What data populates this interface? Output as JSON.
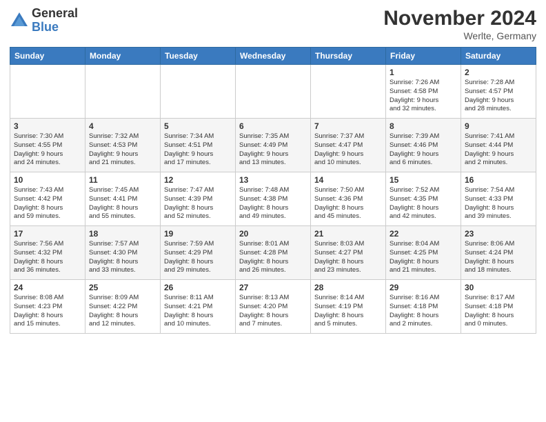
{
  "logo": {
    "general": "General",
    "blue": "Blue"
  },
  "header": {
    "title": "November 2024",
    "location": "Werlte, Germany"
  },
  "weekdays": [
    "Sunday",
    "Monday",
    "Tuesday",
    "Wednesday",
    "Thursday",
    "Friday",
    "Saturday"
  ],
  "weeks": [
    [
      {
        "day": "",
        "info": ""
      },
      {
        "day": "",
        "info": ""
      },
      {
        "day": "",
        "info": ""
      },
      {
        "day": "",
        "info": ""
      },
      {
        "day": "",
        "info": ""
      },
      {
        "day": "1",
        "info": "Sunrise: 7:26 AM\nSunset: 4:58 PM\nDaylight: 9 hours\nand 32 minutes."
      },
      {
        "day": "2",
        "info": "Sunrise: 7:28 AM\nSunset: 4:57 PM\nDaylight: 9 hours\nand 28 minutes."
      }
    ],
    [
      {
        "day": "3",
        "info": "Sunrise: 7:30 AM\nSunset: 4:55 PM\nDaylight: 9 hours\nand 24 minutes."
      },
      {
        "day": "4",
        "info": "Sunrise: 7:32 AM\nSunset: 4:53 PM\nDaylight: 9 hours\nand 21 minutes."
      },
      {
        "day": "5",
        "info": "Sunrise: 7:34 AM\nSunset: 4:51 PM\nDaylight: 9 hours\nand 17 minutes."
      },
      {
        "day": "6",
        "info": "Sunrise: 7:35 AM\nSunset: 4:49 PM\nDaylight: 9 hours\nand 13 minutes."
      },
      {
        "day": "7",
        "info": "Sunrise: 7:37 AM\nSunset: 4:47 PM\nDaylight: 9 hours\nand 10 minutes."
      },
      {
        "day": "8",
        "info": "Sunrise: 7:39 AM\nSunset: 4:46 PM\nDaylight: 9 hours\nand 6 minutes."
      },
      {
        "day": "9",
        "info": "Sunrise: 7:41 AM\nSunset: 4:44 PM\nDaylight: 9 hours\nand 2 minutes."
      }
    ],
    [
      {
        "day": "10",
        "info": "Sunrise: 7:43 AM\nSunset: 4:42 PM\nDaylight: 8 hours\nand 59 minutes."
      },
      {
        "day": "11",
        "info": "Sunrise: 7:45 AM\nSunset: 4:41 PM\nDaylight: 8 hours\nand 55 minutes."
      },
      {
        "day": "12",
        "info": "Sunrise: 7:47 AM\nSunset: 4:39 PM\nDaylight: 8 hours\nand 52 minutes."
      },
      {
        "day": "13",
        "info": "Sunrise: 7:48 AM\nSunset: 4:38 PM\nDaylight: 8 hours\nand 49 minutes."
      },
      {
        "day": "14",
        "info": "Sunrise: 7:50 AM\nSunset: 4:36 PM\nDaylight: 8 hours\nand 45 minutes."
      },
      {
        "day": "15",
        "info": "Sunrise: 7:52 AM\nSunset: 4:35 PM\nDaylight: 8 hours\nand 42 minutes."
      },
      {
        "day": "16",
        "info": "Sunrise: 7:54 AM\nSunset: 4:33 PM\nDaylight: 8 hours\nand 39 minutes."
      }
    ],
    [
      {
        "day": "17",
        "info": "Sunrise: 7:56 AM\nSunset: 4:32 PM\nDaylight: 8 hours\nand 36 minutes."
      },
      {
        "day": "18",
        "info": "Sunrise: 7:57 AM\nSunset: 4:30 PM\nDaylight: 8 hours\nand 33 minutes."
      },
      {
        "day": "19",
        "info": "Sunrise: 7:59 AM\nSunset: 4:29 PM\nDaylight: 8 hours\nand 29 minutes."
      },
      {
        "day": "20",
        "info": "Sunrise: 8:01 AM\nSunset: 4:28 PM\nDaylight: 8 hours\nand 26 minutes."
      },
      {
        "day": "21",
        "info": "Sunrise: 8:03 AM\nSunset: 4:27 PM\nDaylight: 8 hours\nand 23 minutes."
      },
      {
        "day": "22",
        "info": "Sunrise: 8:04 AM\nSunset: 4:25 PM\nDaylight: 8 hours\nand 21 minutes."
      },
      {
        "day": "23",
        "info": "Sunrise: 8:06 AM\nSunset: 4:24 PM\nDaylight: 8 hours\nand 18 minutes."
      }
    ],
    [
      {
        "day": "24",
        "info": "Sunrise: 8:08 AM\nSunset: 4:23 PM\nDaylight: 8 hours\nand 15 minutes."
      },
      {
        "day": "25",
        "info": "Sunrise: 8:09 AM\nSunset: 4:22 PM\nDaylight: 8 hours\nand 12 minutes."
      },
      {
        "day": "26",
        "info": "Sunrise: 8:11 AM\nSunset: 4:21 PM\nDaylight: 8 hours\nand 10 minutes."
      },
      {
        "day": "27",
        "info": "Sunrise: 8:13 AM\nSunset: 4:20 PM\nDaylight: 8 hours\nand 7 minutes."
      },
      {
        "day": "28",
        "info": "Sunrise: 8:14 AM\nSunset: 4:19 PM\nDaylight: 8 hours\nand 5 minutes."
      },
      {
        "day": "29",
        "info": "Sunrise: 8:16 AM\nSunset: 4:18 PM\nDaylight: 8 hours\nand 2 minutes."
      },
      {
        "day": "30",
        "info": "Sunrise: 8:17 AM\nSunset: 4:18 PM\nDaylight: 8 hours\nand 0 minutes."
      }
    ]
  ]
}
